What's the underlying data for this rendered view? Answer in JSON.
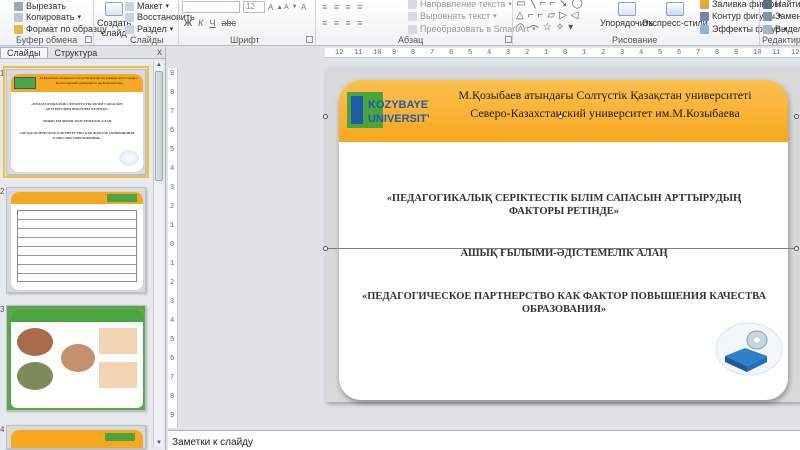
{
  "ribbon": {
    "clipboard": {
      "cut": "Вырезать",
      "copy": "Копировать",
      "format_painter": "Формат по образцу",
      "group_label": "Буфер обмена"
    },
    "slides": {
      "create_slide": "Создать",
      "create_slide_line2": "слайд",
      "layout": "Макет",
      "reset": "Восстановить",
      "section": "Раздел",
      "group_label": "Слайды"
    },
    "font": {
      "size_value": "12",
      "group_label": "Шрифт"
    },
    "paragraph": {
      "text_direction": "Направление текста",
      "align_text": "Выровнять текст",
      "convert_smartart": "Преобразовать в SmartArt",
      "group_label": "Абзац"
    },
    "drawing": {
      "arrange": "Упорядочить",
      "quick_styles": "Экспресс-стили",
      "shape_fill": "Заливка фигуры",
      "shape_outline": "Контур фигуры",
      "shape_effects": "Эффекты фигур",
      "group_label": "Рисование"
    },
    "editing": {
      "find": "Найти",
      "replace": "Заменит",
      "select": "Выделить",
      "group_label": "Редактирование"
    }
  },
  "left_pane": {
    "tabs": [
      "Слайды",
      "Структура"
    ],
    "close": "x",
    "slide_numbers": [
      "1",
      "2",
      "3",
      "4"
    ],
    "thumb1": {
      "header": "М.Қозыбаев атындағы Солтүстік Қазақстан университеті Северо-Казахстанский университет им.М.Козыбаева",
      "title1": "«ПЕДАГОГИКАЛЫҚ СЕРІКТЕСТІК БІЛІМ САПАСЫН АРТТЫРУДЫҢ ФАКТОРЫ РЕТІНДЕ»",
      "title2": "АШЫҚ ҒЫЛЫМИ-ӘДІСТЕМЕЛІК АЛАҢ",
      "title3": "«ПЕДАГОГИЧЕСКОЕ ПАРТНЕРСТВО КАК ФАКТОР ПОВЫШЕНИЯ КАЧЕСТВА ОБРАЗОВАНИЯ»"
    }
  },
  "ruler": {
    "h_ticks": [
      "12",
      "11",
      "10",
      "9",
      "8",
      "7",
      "6",
      "5",
      "4",
      "3",
      "2",
      "1",
      "0",
      "1",
      "2",
      "3",
      "4",
      "5",
      "6",
      "7",
      "8",
      "9",
      "10",
      "11",
      "12"
    ],
    "v_ticks": [
      "9",
      "8",
      "7",
      "6",
      "5",
      "4",
      "3",
      "2",
      "1",
      "0",
      "1",
      "2",
      "3",
      "4",
      "5",
      "6",
      "7",
      "8",
      "9"
    ]
  },
  "slide": {
    "logo_line1": "KOZYBAYEV",
    "logo_line2": "UNIVERSITY",
    "university_kz": "М.Қозыбаев атындағы Солтүстік Қазақстан университеті",
    "university_ru": "Северо-Казахстанский университет им.М.Козыбаева",
    "title_kz": "«ПЕДАГОГИКАЛЫҚ СЕРІКТЕСТІК БІЛІМ САПАСЫН АРТТЫРУДЫҢ ФАКТОРЫ РЕТІНДЕ»",
    "subtitle_kz": "АШЫҚ ҒЫЛЫМИ-ӘДІСТЕМЕЛІК АЛАҢ",
    "title_ru": "«ПЕДАГОГИЧЕСКОЕ ПАРТНЕРСТВО КАК ФАКТОР ПОВЫШЕНИЯ КАЧЕСТВА ОБРАЗОВАНИЯ»"
  },
  "notes": {
    "placeholder": "Заметки к слайду"
  },
  "colors": {
    "accent_orange": "#f7a821",
    "logo_green": "#4aa541",
    "logo_blue": "#1f5aa6",
    "selection": "#f3c03c"
  }
}
